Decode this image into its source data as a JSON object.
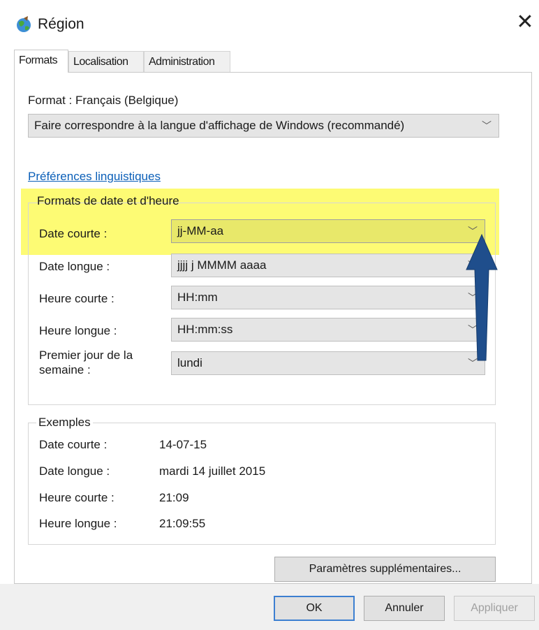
{
  "window": {
    "title": "Région"
  },
  "tabs": [
    {
      "label": "Formats"
    },
    {
      "label": "Localisation"
    },
    {
      "label": "Administration"
    }
  ],
  "format": {
    "label": "Format : Français (Belgique)",
    "selected": "Faire correspondre à la langue d'affichage de Windows (recommandé)"
  },
  "language_link": "Préférences linguistiques",
  "datetime_group": {
    "title": "Formats de date et d'heure",
    "rows": [
      {
        "label": "Date courte :",
        "value": "jj-MM-aa"
      },
      {
        "label": "Date longue :",
        "value": "jjjj j MMMM aaaa"
      },
      {
        "label": "Heure courte :",
        "value": "HH:mm"
      },
      {
        "label": "Heure longue :",
        "value": "HH:mm:ss"
      },
      {
        "label": "Premier jour de la semaine :",
        "value": "lundi"
      }
    ]
  },
  "examples": {
    "title": "Exemples",
    "rows": [
      {
        "label": "Date courte :",
        "value": "14-07-15"
      },
      {
        "label": "Date longue :",
        "value": "mardi 14 juillet 2015"
      },
      {
        "label": "Heure courte :",
        "value": "21:09"
      },
      {
        "label": "Heure longue :",
        "value": "21:09:55"
      }
    ]
  },
  "buttons": {
    "additional": "Paramètres supplémentaires...",
    "ok": "OK",
    "cancel": "Annuler",
    "apply": "Appliquer"
  },
  "colors": {
    "highlight": "#fdfb68",
    "arrow": "#1f4e8c",
    "link": "#0b5fb8"
  },
  "icons": {
    "title": "globe-icon",
    "close": "close-icon",
    "dropdown": "chevron-down-icon",
    "annotation": "up-arrow-annotation"
  }
}
